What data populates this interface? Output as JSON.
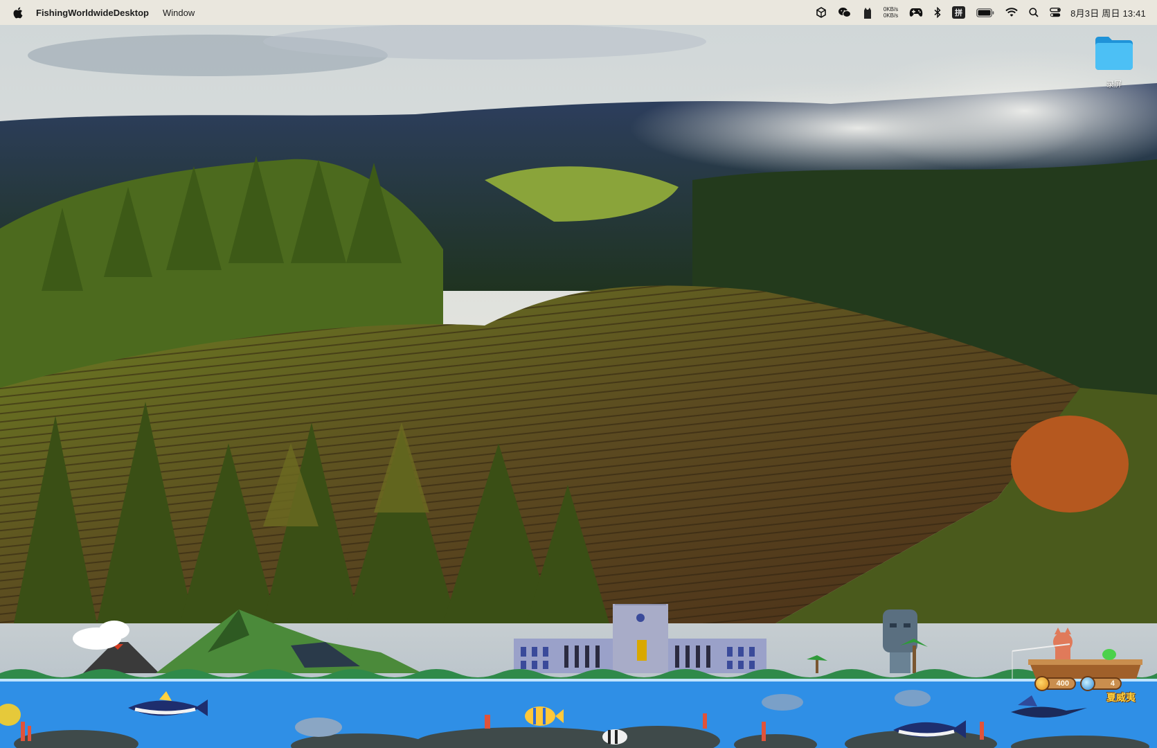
{
  "menubar": {
    "app_name": "FishingWorldwideDesktop",
    "menu_items": [
      "Window"
    ],
    "net_up": "0KB/s",
    "net_down": "0KB/s",
    "ime": "拼",
    "clock": "8月3日 周日  13:41",
    "status_icons": [
      "unity-icon",
      "wechat-icon",
      "cat-icon",
      "netspeed",
      "gamepad-icon",
      "bluetooth-icon",
      "input-method-icon",
      "battery-icon",
      "wifi-icon",
      "spotlight-search-icon",
      "control-center-icon"
    ]
  },
  "desktop": {
    "folder_label": "录屏"
  },
  "game": {
    "coins": "400",
    "gems": "4",
    "location": "夏威夷"
  },
  "colors": {
    "water": "#2f8fe6",
    "water_top": "#bfe4ff",
    "menubar": "#ece8de",
    "folder": "#3fb0f0"
  }
}
